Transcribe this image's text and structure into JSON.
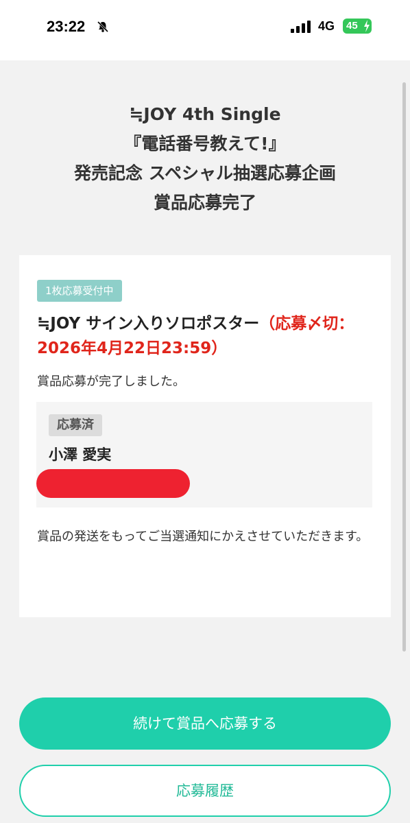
{
  "status_bar": {
    "time": "23:22",
    "network": "4G",
    "battery": "45",
    "icons": [
      "bell-slash-icon",
      "signal-icon",
      "battery-charging-icon"
    ]
  },
  "header": {
    "line1": "≒JOY 4th Single",
    "line2": "『電話番号教えて!』",
    "line3": "発売記念 スペシャル抽選応募企画",
    "line4": "賞品応募完了"
  },
  "card": {
    "badge": "1枚応募受付中",
    "prize_name": "≒JOY サイン入りソロポスター",
    "deadline": "（応募〆切：2026年4月22日23:59）",
    "complete_message": "賞品応募が完了しました。",
    "entry": {
      "status": "応募済",
      "name": "小澤 愛実"
    },
    "shipping_note": "賞品の発送をもってご当選通知にかえさせていただきます。"
  },
  "buttons": {
    "continue": "続けて賞品へ応募する",
    "history": "応募履歴"
  },
  "colors": {
    "accent": "#1fcfab",
    "badge": "#8ecfc9",
    "deadline": "#e0251b",
    "redaction": "#ee2230"
  }
}
